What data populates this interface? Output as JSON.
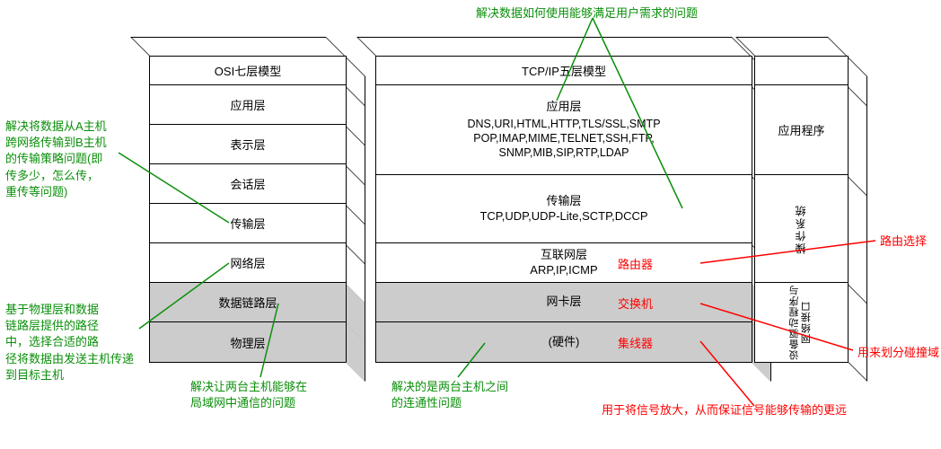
{
  "osi": {
    "title": "OSI七层模型",
    "layers": [
      "应用层",
      "表示层",
      "会话层",
      "传输层",
      "网络层",
      "数据链路层",
      "物理层"
    ]
  },
  "tcp": {
    "title": "TCP/IP五层模型",
    "application": {
      "name": "应用层",
      "protocols": "DNS,URI,HTML,HTTP,TLS/SSL,SMTP\nPOP,IMAP,MIME,TELNET,SSH,FTP,\nSNMP,MIB,SIP,RTP,LDAP"
    },
    "transport": {
      "name": "传输层",
      "protocols": "TCP,UDP,UDP-Lite,SCTP,DCCP"
    },
    "internet": {
      "name": "互联网层",
      "protocols": "ARP,IP,ICMP",
      "device": "路由器"
    },
    "nic": {
      "name": "网卡层",
      "device": "交换机"
    },
    "hardware": {
      "name": "(硬件)",
      "device": "集线器"
    }
  },
  "sidecol": {
    "title": "",
    "app_label": "应用程序",
    "os_label": "操作系统",
    "driver_label": "设备驱动程序与网络接口"
  },
  "annotations": {
    "a1": "解决将数据从A主机\n跨网络传输到B主机\n的传输策略问题(即\n传多少，怎么传，\n重传等问题)",
    "a2": "基于物理层和数据\n链路层提供的路径\n中，选择合适的路\n径将数据由发送主机传递\n到目标主机",
    "a3": "解决让两台主机能够在\n局域网中通信的问题",
    "a4": "解决的是两台主机之间\n的连通性问题",
    "a5": "解决数据如何使用能够满足用户需求的问题",
    "a6": "路由选择",
    "a7": "用来划分碰撞域",
    "a8": "用于将信号放大，从而保证信号能够传输的更远"
  }
}
